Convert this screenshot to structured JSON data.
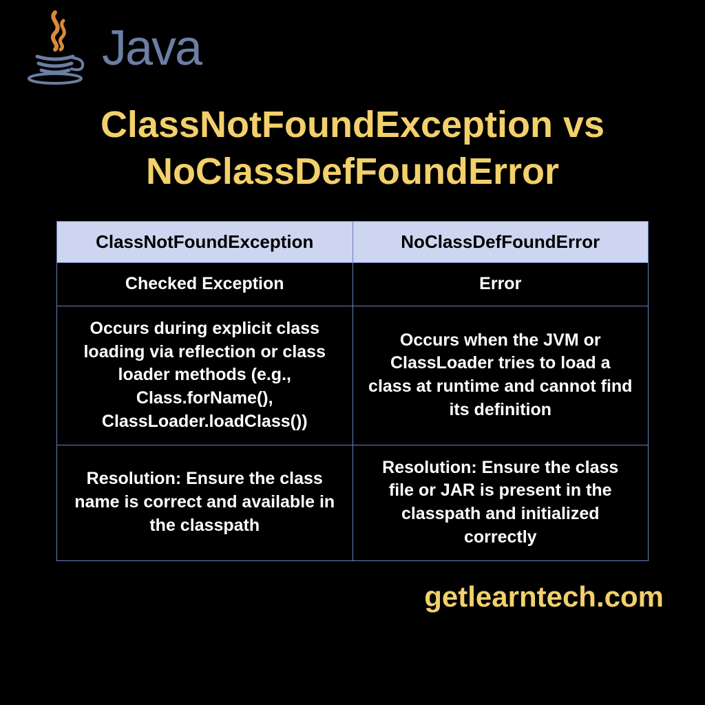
{
  "logo_text": "Java",
  "title": "ClassNotFoundException vs NoClassDefFoundError",
  "headers": {
    "left": "ClassNotFoundException",
    "right": "NoClassDefFoundError"
  },
  "rows": [
    {
      "left": "Checked Exception",
      "right": "Error"
    },
    {
      "left": "Occurs during explicit class loading via reflection or class loader methods (e.g., Class.forName(), ClassLoader.loadClass())",
      "right": "Occurs when the JVM or ClassLoader tries to load a class at runtime and cannot find its definition"
    },
    {
      "left": "Resolution: Ensure the class name is correct and available in the classpath",
      "right": "Resolution: Ensure the class file or JAR is present in the classpath and initialized correctly"
    }
  ],
  "footer": "getlearntech.com",
  "colors": {
    "accent": "#f2d06b",
    "header_bg": "#cdd5f0",
    "border": "#6b7fb8",
    "logo_blue": "#6b7fa3",
    "steam": "#d98b3c"
  }
}
